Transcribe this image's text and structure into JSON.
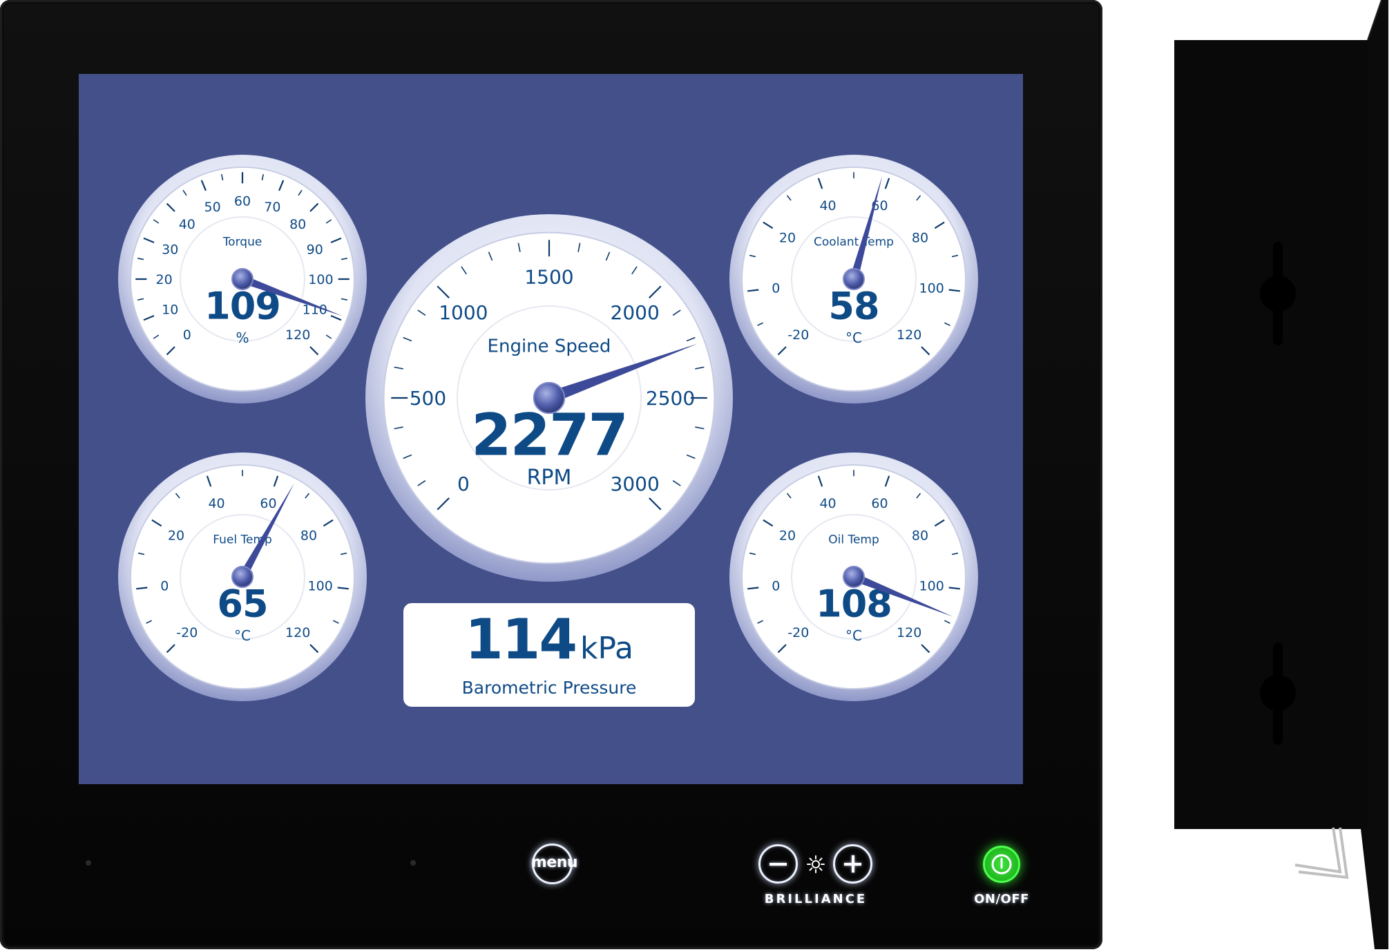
{
  "colors": {
    "screen_bg": "#44508a",
    "gauge_text": "#0e4a86",
    "gauge_face": "#ffffff",
    "power_green": "#2bd42b"
  },
  "gauges": {
    "torque": {
      "title": "Torque",
      "value": "109",
      "unit": "%",
      "min": 0,
      "max": 120,
      "reading": 109,
      "tick_labels": [
        "0",
        "10",
        "20",
        "30",
        "40",
        "50",
        "60",
        "70",
        "80",
        "90",
        "100",
        "110",
        "120"
      ]
    },
    "engine_speed": {
      "title": "Engine Speed",
      "value": "2277",
      "unit": "RPM",
      "min": 0,
      "max": 3000,
      "reading": 2277,
      "tick_labels": [
        "0",
        "500",
        "1000",
        "1500",
        "2000",
        "2500",
        "3000"
      ]
    },
    "coolant_temp": {
      "title": "Coolant Temp",
      "value": "58",
      "unit": "°C",
      "min": -20,
      "max": 120,
      "reading": 58,
      "tick_labels": [
        "-20",
        "0",
        "20",
        "40",
        "60",
        "80",
        "100",
        "120"
      ]
    },
    "fuel_temp": {
      "title": "Fuel Temp",
      "value": "65",
      "unit": "°C",
      "min": -20,
      "max": 120,
      "reading": 65,
      "tick_labels": [
        "-20",
        "0",
        "20",
        "40",
        "60",
        "80",
        "100",
        "120"
      ]
    },
    "oil_temp": {
      "title": "Oil Temp",
      "value": "108",
      "unit": "°C",
      "min": -20,
      "max": 120,
      "reading": 108,
      "tick_labels": [
        "-20",
        "0",
        "20",
        "40",
        "60",
        "80",
        "100",
        "120"
      ]
    }
  },
  "barometric": {
    "value": "114",
    "unit": "kPa",
    "label": "Barometric Pressure"
  },
  "controls": {
    "menu_label": "menu",
    "brilliance_label": "BRILLIANCE",
    "power_label": "ON/OFF",
    "minus_icon": "minus-icon",
    "plus_icon": "plus-icon",
    "sun_icon": "sun-icon",
    "power_icon": "power-icon"
  }
}
